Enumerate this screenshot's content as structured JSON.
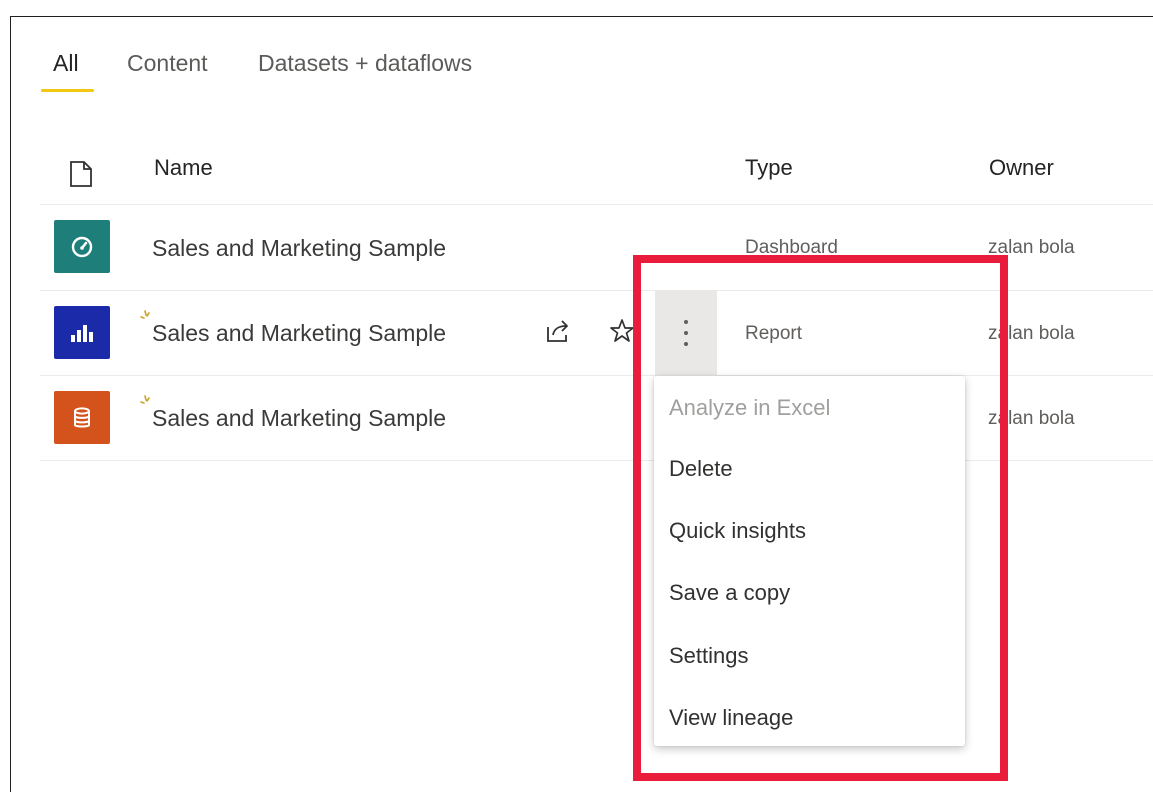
{
  "tabs": [
    {
      "label": "All",
      "active": true
    },
    {
      "label": "Content",
      "active": false
    },
    {
      "label": "Datasets + dataflows",
      "active": false
    }
  ],
  "columns": {
    "name": "Name",
    "type": "Type",
    "owner": "Owner"
  },
  "rows": [
    {
      "icon": "dashboard-gauge-icon",
      "icon_color": "#1e7f7a",
      "name": "Sales and Marketing Sample",
      "type": "Dashboard",
      "owner": "zalan bola",
      "new": false
    },
    {
      "icon": "report-bar-chart-icon",
      "icon_color": "#1a2aa8",
      "name": "Sales and Marketing Sample",
      "type": "Report",
      "owner": "zalan bola",
      "new": true
    },
    {
      "icon": "dataset-database-icon",
      "icon_color": "#d4521b",
      "name": "Sales and Marketing Sample",
      "type": "",
      "owner": "zalan bola",
      "new": true
    }
  ],
  "context_menu": {
    "items": [
      {
        "label": "Analyze in Excel",
        "disabled": true
      },
      {
        "label": "Delete",
        "disabled": false
      },
      {
        "label": "Quick insights",
        "disabled": false
      },
      {
        "label": "Save a copy",
        "disabled": false
      },
      {
        "label": "Settings",
        "disabled": false
      },
      {
        "label": "View lineage",
        "disabled": false
      }
    ]
  },
  "colors": {
    "accent_underline": "#f2c811",
    "highlight_box": "#ea1c3c"
  }
}
